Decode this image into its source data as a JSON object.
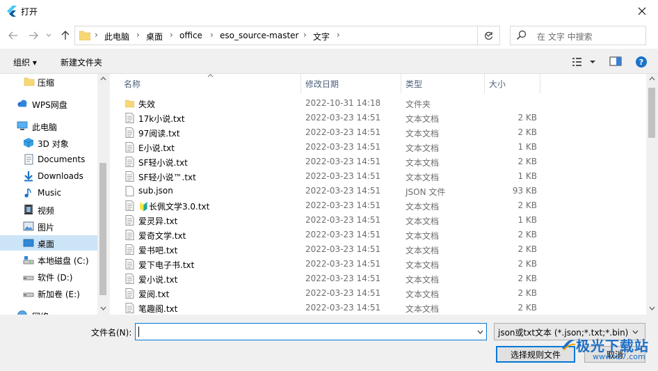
{
  "window": {
    "title": "打开"
  },
  "address": {
    "crumbs": [
      "此电脑",
      "桌面",
      "office",
      "eso_source-master",
      "文字"
    ]
  },
  "search": {
    "placeholder": "在 文字 中搜索"
  },
  "toolbar": {
    "organize_label": "组织 ▾",
    "new_folder_label": "新建文件夹",
    "help_label": "?"
  },
  "nav": {
    "items": [
      {
        "label": "压缩",
        "icon": "folder-icon"
      },
      {
        "label": "WPS网盘",
        "icon": "cloud-icon"
      },
      {
        "label": "此电脑",
        "icon": "computer-icon"
      },
      {
        "label": "3D 对象",
        "icon": "3d-objects-icon"
      },
      {
        "label": "Documents",
        "icon": "documents-icon"
      },
      {
        "label": "Downloads",
        "icon": "downloads-icon"
      },
      {
        "label": "Music",
        "icon": "music-icon"
      },
      {
        "label": "视频",
        "icon": "video-icon"
      },
      {
        "label": "图片",
        "icon": "pictures-icon"
      },
      {
        "label": "桌面",
        "icon": "desktop-icon",
        "selected": true
      },
      {
        "label": "本地磁盘 (C:)",
        "icon": "drive-c-icon"
      },
      {
        "label": "软件 (D:)",
        "icon": "drive-icon"
      },
      {
        "label": "新加卷 (E:)",
        "icon": "drive-icon"
      },
      {
        "label": "网络",
        "icon": "network-icon"
      }
    ]
  },
  "list": {
    "headers": {
      "name": "名称",
      "date": "修改日期",
      "type": "类型",
      "size": "大小"
    },
    "rows": [
      {
        "name": "失效",
        "date": "2022-10-31 14:18",
        "type": "文件夹",
        "size": "",
        "icon": "folder-icon"
      },
      {
        "name": "17k小说.txt",
        "date": "2022-03-23 14:51",
        "type": "文本文档",
        "size": "2 KB",
        "icon": "text-file-icon"
      },
      {
        "name": "97阅读.txt",
        "date": "2022-03-23 14:51",
        "type": "文本文档",
        "size": "2 KB",
        "icon": "text-file-icon"
      },
      {
        "name": "E小说.txt",
        "date": "2022-03-23 14:51",
        "type": "文本文档",
        "size": "1 KB",
        "icon": "text-file-icon"
      },
      {
        "name": "SF轻小说.txt",
        "date": "2022-03-23 14:51",
        "type": "文本文档",
        "size": "2 KB",
        "icon": "text-file-icon"
      },
      {
        "name": "SF轻小说™.txt",
        "date": "2022-03-23 14:51",
        "type": "文本文档",
        "size": "1 KB",
        "icon": "text-file-icon"
      },
      {
        "name": "sub.json",
        "date": "2022-03-23 14:51",
        "type": "JSON 文件",
        "size": "93 KB",
        "icon": "file-icon"
      },
      {
        "name": "🔰长佩文学3.0.txt",
        "date": "2022-03-23 14:51",
        "type": "文本文档",
        "size": "2 KB",
        "icon": "text-file-icon"
      },
      {
        "name": "爱灵异.txt",
        "date": "2022-03-23 14:51",
        "type": "文本文档",
        "size": "1 KB",
        "icon": "text-file-icon"
      },
      {
        "name": "爱奇文学.txt",
        "date": "2022-03-23 14:51",
        "type": "文本文档",
        "size": "2 KB",
        "icon": "text-file-icon"
      },
      {
        "name": "爱书吧.txt",
        "date": "2022-03-23 14:51",
        "type": "文本文档",
        "size": "2 KB",
        "icon": "text-file-icon"
      },
      {
        "name": "爱下电子书.txt",
        "date": "2022-03-23 14:51",
        "type": "文本文档",
        "size": "2 KB",
        "icon": "text-file-icon"
      },
      {
        "name": "爱小说.txt",
        "date": "2022-03-23 14:51",
        "type": "文本文档",
        "size": "2 KB",
        "icon": "text-file-icon"
      },
      {
        "name": "爱阅.txt",
        "date": "2022-03-23 14:51",
        "type": "文本文档",
        "size": "2 KB",
        "icon": "text-file-icon"
      },
      {
        "name": "笔趣阁.txt",
        "date": "2022-03-23 14:51",
        "type": "文本文档",
        "size": "2 KB",
        "icon": "text-file-icon"
      }
    ]
  },
  "bottom": {
    "filename_label": "文件名(N):",
    "filename_value": "",
    "filter_value": "json或txt文本 (*.json;*.txt;*.bin)",
    "open_label": "选择规则文件",
    "cancel_label": "取消"
  },
  "watermark": {
    "line1": "极光下载站",
    "line2": "www.xz7.com"
  },
  "colors": {
    "accent": "#0078d7",
    "selected_bg": "#cce4f7",
    "folder": "#f8d775"
  }
}
